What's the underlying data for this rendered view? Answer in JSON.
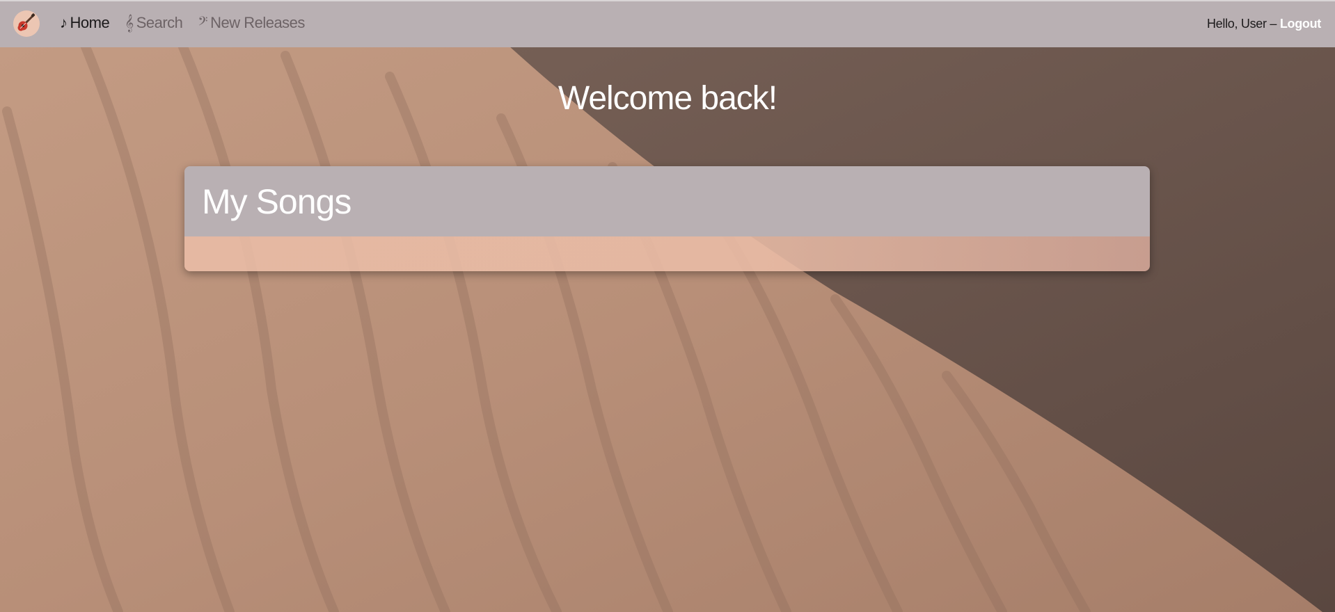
{
  "navbar": {
    "logo_icon": "guitar-icon",
    "links": [
      {
        "glyph": "♪",
        "label": "Home",
        "icon": "music-note-icon",
        "active": true
      },
      {
        "glyph": "𝄞",
        "label": "Search",
        "icon": "treble-clef-icon",
        "active": false
      },
      {
        "glyph": "𝄢",
        "label": "New Releases",
        "icon": "bass-clef-icon",
        "active": false
      }
    ],
    "greeting": "Hello, User – ",
    "logout_label": "Logout"
  },
  "main": {
    "welcome": "Welcome back!",
    "songs_card": {
      "title": "My Songs",
      "items": []
    }
  },
  "colors": {
    "navbar_bg": "#b9b0b3",
    "card_header_bg": "#b9b0b3",
    "card_body_bg": "#ecbea8",
    "sand_light": "#c39a82",
    "sand_shadow": "#6e5a50"
  }
}
